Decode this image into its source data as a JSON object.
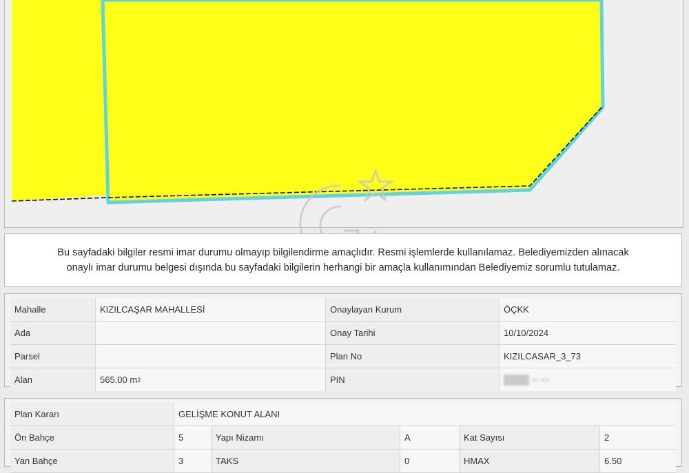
{
  "notice": {
    "line1": "Bu sayfadaki bilgiler resmi imar durumu olmayıp bilgilendirme amaçlıdır. Resmi işlemlerde kullanılamaz. Belediyemizden alınacak",
    "line2": "onaylı imar durumu belgesi dışında bu sayfadaki bilgilerin herhangi bir amaçla kullanımından Belediyemiz sorumlu tutulamaz."
  },
  "colors": {
    "parcel_fill": "#ffff1a",
    "parcel_border": "#5fd3e0",
    "background": "#efefef"
  },
  "parcel_table": {
    "mahalle_label": "Mahalle",
    "mahalle_value": "KIZILCAŞAR MAHALLESİ",
    "kurum_label": "Onaylayan Kurum",
    "kurum_value": "ÖÇKK",
    "ada_label": "Ada",
    "onay_tarihi_label": "Onay Tarihi",
    "onay_tarihi_value": "10/10/2024",
    "parsel_label": "Parsel",
    "plan_no_label": "Plan No",
    "plan_no_value": "KIZILCASAR_3_73",
    "alan_label": "Alan",
    "alan_value": "565.00 m",
    "alan_unit_sup": "2",
    "pin_label": "PIN"
  },
  "plan_table": {
    "plan_karari_label": "Plan Kararı",
    "plan_karari_value": "GELİŞME KONUT ALANI",
    "on_bahce_label": "Ön Bahçe",
    "on_bahce_value": "5",
    "yapi_nizami_label": "Yapı Nizamı",
    "yapi_nizami_value": "A",
    "kat_sayisi_label": "Kat Sayısı",
    "kat_sayisi_value": "2",
    "yan_bahce_label": "Yan Bahçe",
    "yan_bahce_value": "3",
    "taks_label": "TAKS",
    "taks_value": "0",
    "hmax_label": "HMAX",
    "hmax_value": "6.50"
  }
}
